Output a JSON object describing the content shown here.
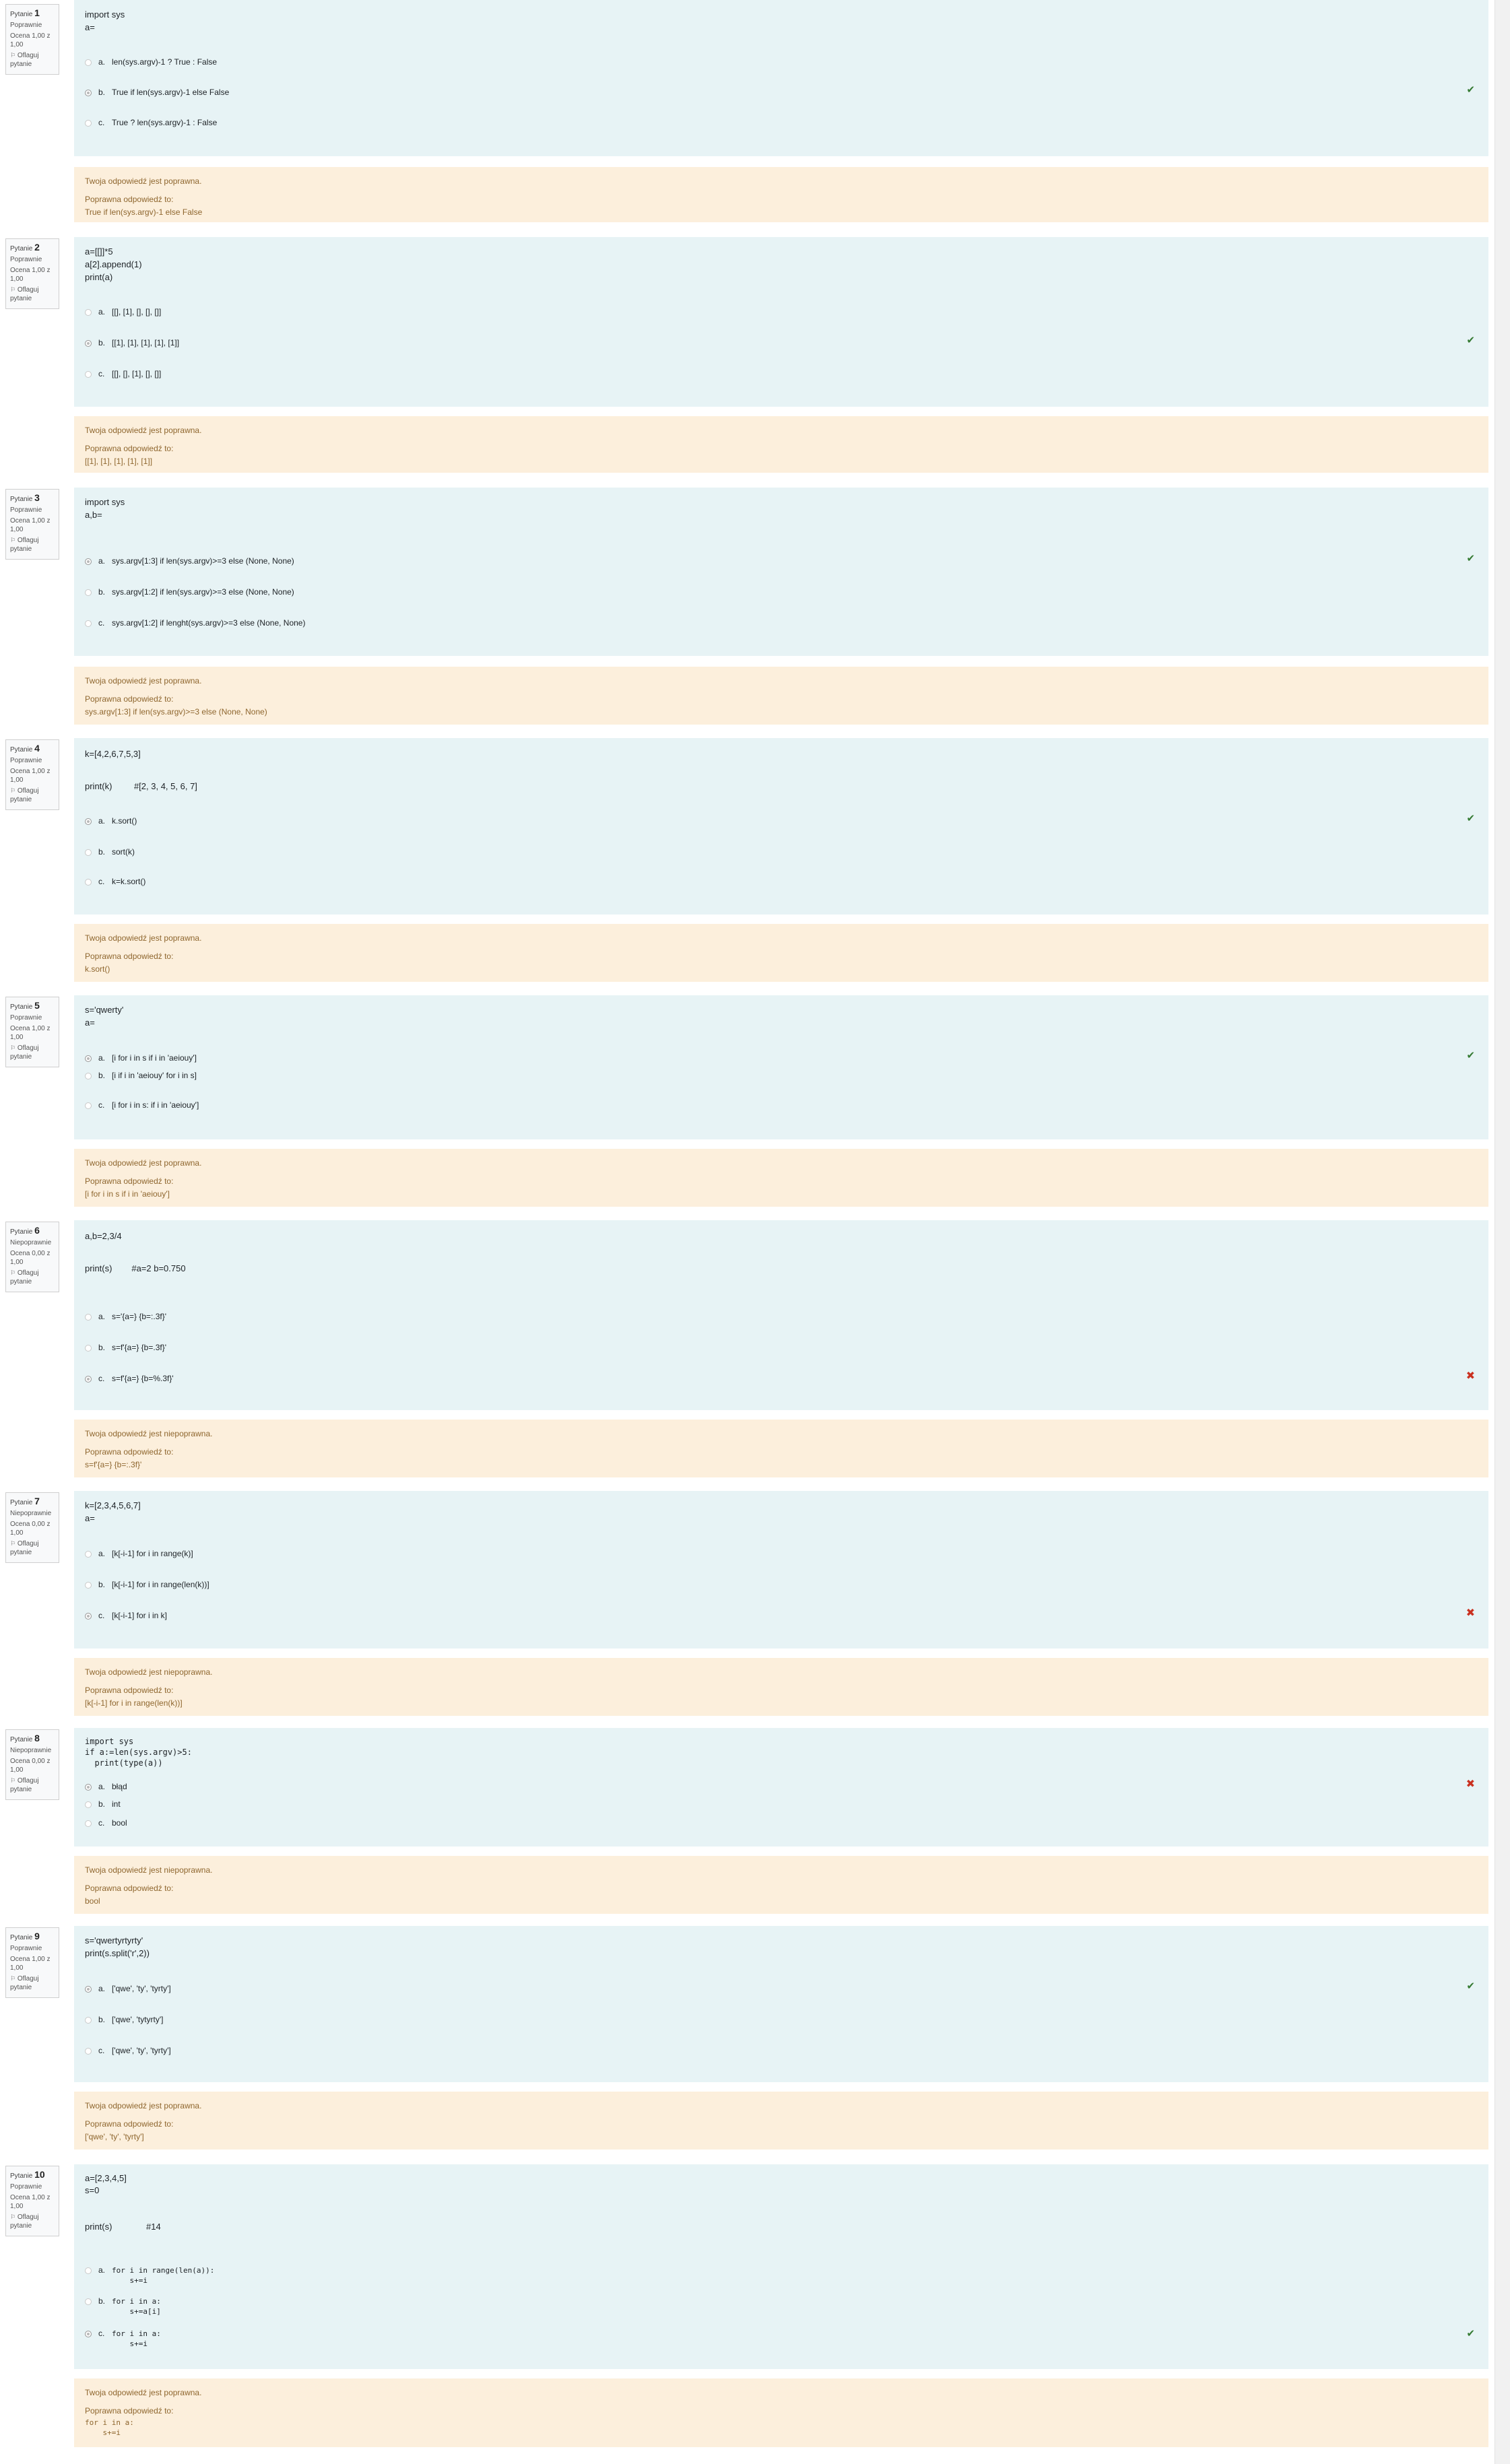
{
  "labels": {
    "question_word": "Pytanie",
    "flag": "Oflaguj pytanie"
  },
  "questions": [
    {
      "no": "1",
      "status": "Poprawnie",
      "mark": "Ocena 1,00 z 1,00",
      "text": "import sys\na=",
      "answers": [
        {
          "letter": "a.",
          "text": "len(sys.argv)-1 ? True : False",
          "selected": false
        },
        {
          "letter": "b.",
          "text": "True if len(sys.argv)-1 else False",
          "selected": true
        },
        {
          "letter": "c.",
          "text": "True ? len(sys.argv)-1 : False",
          "selected": false
        }
      ],
      "result": "correct",
      "feedback": "Twoja odpowiedź jest poprawna.",
      "correct_label": "Poprawna odpowiedź to:",
      "correct_answer": "True if len(sys.argv)-1 else False"
    },
    {
      "no": "2",
      "status": "Poprawnie",
      "mark": "Ocena 1,00 z 1,00",
      "text": "a=[[]]*5\na[2].append(1)\nprint(a)",
      "answers": [
        {
          "letter": "a.",
          "text": "[[], [1], [], [], []]",
          "selected": false
        },
        {
          "letter": "b.",
          "text": "[[1], [1], [1], [1], [1]]",
          "selected": true
        },
        {
          "letter": "c.",
          "text": "[[], [], [1], [], []]",
          "selected": false
        }
      ],
      "result": "correct",
      "feedback": "Twoja odpowiedź jest poprawna.",
      "correct_label": "Poprawna odpowiedź to:",
      "correct_answer": "[[1], [1], [1], [1], [1]]"
    },
    {
      "no": "3",
      "status": "Poprawnie",
      "mark": "Ocena 1,00 z 1,00",
      "text": "import sys\na,b=",
      "answers": [
        {
          "letter": "a.",
          "text": "sys.argv[1:3] if len(sys.argv)>=3 else (None, None)",
          "selected": true
        },
        {
          "letter": "b.",
          "text": "sys.argv[1:2] if len(sys.argv)>=3 else (None, None)",
          "selected": false
        },
        {
          "letter": "c.",
          "text": "sys.argv[1:2] if lenght(sys.argv)>=3 else (None, None)",
          "selected": false
        }
      ],
      "result": "correct",
      "feedback": "Twoja odpowiedź jest poprawna.",
      "correct_label": "Poprawna odpowiedź to:",
      "correct_answer": "sys.argv[1:3] if len(sys.argv)>=3 else (None, None)"
    },
    {
      "no": "4",
      "status": "Poprawnie",
      "mark": "Ocena 1,00 z 1,00",
      "text": "k=[4,2,6,7,5,3]\n\nprint(k)         #[2, 3, 4, 5, 6, 7]",
      "answers": [
        {
          "letter": "a.",
          "text": "k.sort()",
          "selected": true
        },
        {
          "letter": "b.",
          "text": "sort(k)",
          "selected": false
        },
        {
          "letter": "c.",
          "text": "k=k.sort()",
          "selected": false
        }
      ],
      "result": "correct",
      "feedback": "Twoja odpowiedź jest poprawna.",
      "correct_label": "Poprawna odpowiedź to:",
      "correct_answer": "k.sort()"
    },
    {
      "no": "5",
      "status": "Poprawnie",
      "mark": "Ocena 1,00 z 1,00",
      "text": "s='qwerty'\na=",
      "answers": [
        {
          "letter": "a.",
          "text": "[i for i in s if i in 'aeiouy']",
          "selected": true
        },
        {
          "letter": "b.",
          "text": "[i if i in 'aeiouy' for i in s]",
          "selected": false
        },
        {
          "letter": "c.",
          "text": "[i for i in s: if i in 'aeiouy']",
          "selected": false
        }
      ],
      "result": "correct",
      "feedback": "Twoja odpowiedź jest poprawna.",
      "correct_label": "Poprawna odpowiedź to:",
      "correct_answer": "[i for i in s if i in 'aeiouy']"
    },
    {
      "no": "6",
      "status": "Niepoprawnie",
      "mark": "Ocena 0,00 z 1,00",
      "text": "a,b=2,3/4\n\nprint(s)        #a=2 b=0.750",
      "answers": [
        {
          "letter": "a.",
          "text": "s='{a=} {b=:.3f}'",
          "selected": false
        },
        {
          "letter": "b.",
          "text": "s=f'{a=} {b=.3f}'",
          "selected": false
        },
        {
          "letter": "c.",
          "text": "s=f'{a=} {b=%.3f}'",
          "selected": true
        }
      ],
      "result": "incorrect",
      "feedback": "Twoja odpowiedź jest niepoprawna.",
      "correct_label": "Poprawna odpowiedź to:",
      "correct_answer": "s=f'{a=} {b=:.3f}'"
    },
    {
      "no": "7",
      "status": "Niepoprawnie",
      "mark": "Ocena 0,00 z 1,00",
      "text": "k=[2,3,4,5,6,7]\na=",
      "answers": [
        {
          "letter": "a.",
          "text": "[k[-i-1] for i in range(k)]",
          "selected": false
        },
        {
          "letter": "b.",
          "text": "[k[-i-1] for i in range(len(k))]",
          "selected": false
        },
        {
          "letter": "c.",
          "text": "[k[-i-1] for i in k]",
          "selected": true
        }
      ],
      "result": "incorrect",
      "feedback": "Twoja odpowiedź jest niepoprawna.",
      "correct_label": "Poprawna odpowiedź to:",
      "correct_answer": "[k[-i-1] for i in range(len(k))]"
    },
    {
      "no": "8",
      "status": "Niepoprawnie",
      "mark": "Ocena 0,00 z 1,00",
      "text": "import sys\nif a:=len(sys.argv)>5:\n  print(type(a))",
      "answers": [
        {
          "letter": "a.",
          "text": "błąd",
          "selected": true
        },
        {
          "letter": "b.",
          "text": "int",
          "selected": false
        },
        {
          "letter": "c.",
          "text": "bool",
          "selected": false
        }
      ],
      "result": "incorrect",
      "feedback": "Twoja odpowiedź jest niepoprawna.",
      "correct_label": "Poprawna odpowiedź to:",
      "correct_answer": "bool"
    },
    {
      "no": "9",
      "status": "Poprawnie",
      "mark": "Ocena 1,00 z 1,00",
      "text": "s='qwertyrtyrty'\nprint(s.split('r',2))",
      "answers": [
        {
          "letter": "a.",
          "text": "['qwe', 'ty', 'tyrty']",
          "selected": true
        },
        {
          "letter": "b.",
          "text": "['qwe', 'tytyrty']",
          "selected": false
        },
        {
          "letter": "c.",
          "text": "['qwe', 'ty', 'tyrty']",
          "selected": false
        }
      ],
      "result": "correct",
      "feedback": "Twoja odpowiedź jest poprawna.",
      "correct_label": "Poprawna odpowiedź to:",
      "correct_answer": "['qwe', 'ty', 'tyrty']"
    },
    {
      "no": "10",
      "status": "Poprawnie",
      "mark": "Ocena 1,00 z 1,00",
      "text": "a=[2,3,4,5]\ns=0\n\n\nprint(s)              #14",
      "answers": [
        {
          "letter": "a.",
          "text": "for i in range(len(a)):\n    s+=i",
          "selected": false
        },
        {
          "letter": "b.",
          "text": "for i in a:\n    s+=a[i]",
          "selected": false
        },
        {
          "letter": "c.",
          "text": "for i in a:\n    s+=i",
          "selected": true
        }
      ],
      "result": "correct",
      "feedback": "Twoja odpowiedź jest poprawna.",
      "correct_label": "Poprawna odpowiedź to:",
      "correct_answer": "for i in a:\n    s+=i"
    }
  ]
}
